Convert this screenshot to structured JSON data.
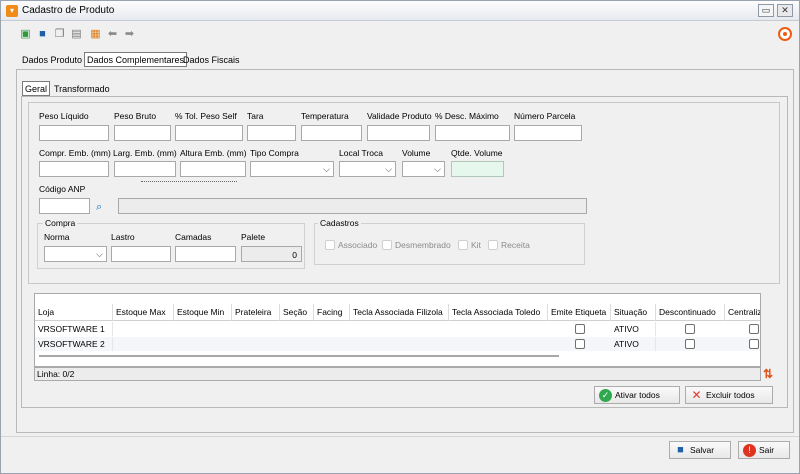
{
  "window": {
    "title": "Cadastro de Produto",
    "min": "▭",
    "close": "✕"
  },
  "toolbar": [
    "new-icon",
    "save-icon",
    "copy-icon",
    "document-icon",
    "report-icon",
    "back-arrow-icon",
    "forward-arrow-icon"
  ],
  "main_tabs": [
    "Dados Produto",
    "Dados Complementares",
    "Dados Fiscais"
  ],
  "sub_tabs": [
    "Geral",
    "Transformado"
  ],
  "form": {
    "peso_liquido": "Peso Líquido",
    "peso_bruto": "Peso Bruto",
    "tol_peso_self": "% Tol. Peso Self",
    "tara": "Tara",
    "temperatura": "Temperatura",
    "validade_produto": "Validade Produto",
    "desc_maximo": "% Desc. Máximo",
    "numero_parcela": "Número Parcela",
    "compr_emb": "Compr. Emb. (mm)",
    "larg_emb": "Larg. Emb. (mm)",
    "altura_emb": "Altura Emb. (mm)",
    "tipo_compra": "Tipo Compra",
    "local_troca": "Local Troca",
    "volume": "Volume",
    "qtde_volume": "Qtde. Volume",
    "codigo_anp": "Código ANP"
  },
  "compra": {
    "title": "Compra",
    "norma": "Norma",
    "lastro": "Lastro",
    "camadas": "Camadas",
    "palete": "Palete",
    "palete_value": "0"
  },
  "cadastros": {
    "title": "Cadastros",
    "items": [
      "Associado",
      "Desmembrado",
      "Kit",
      "Receita"
    ]
  },
  "grid": {
    "columns": [
      "Loja",
      "Estoque Max",
      "Estoque Min",
      "Prateleira",
      "Seção",
      "Facing",
      "Tecla Associada Filizola",
      "Tecla Associada Toledo",
      "Emite Etiqueta",
      "Situação",
      "Descontinuado",
      "Centraliz"
    ],
    "rows": [
      {
        "loja": "VRSOFTWARE 1",
        "situacao": "ATIVO"
      },
      {
        "loja": "VRSOFTWARE 2",
        "situacao": "ATIVO"
      }
    ]
  },
  "status": {
    "text": "Linha: 0/2"
  },
  "buttons": {
    "ativar_todos": "Ativar todos",
    "excluir_todos": "Excluir todos",
    "salvar": "Salvar",
    "sair": "Sair"
  }
}
